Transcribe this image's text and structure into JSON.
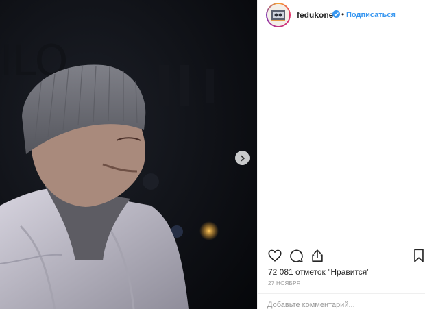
{
  "post": {
    "username": "fedukone",
    "follow_label": "Подписаться",
    "separator": "•",
    "likes_text": "72 081 отметок \"Нравится\"",
    "date": "27 НОЯБРЯ",
    "comment_placeholder": "Добавьте комментарий..."
  },
  "icons": {
    "like": "heart-icon",
    "comment": "comment-icon",
    "share": "share-icon",
    "save": "bookmark-icon",
    "next": "chevron-right-icon",
    "verified": "verified-badge-icon"
  },
  "colors": {
    "link_blue": "#3897f0",
    "verified_blue": "#3897f0",
    "text": "#262626",
    "muted": "#999999"
  }
}
